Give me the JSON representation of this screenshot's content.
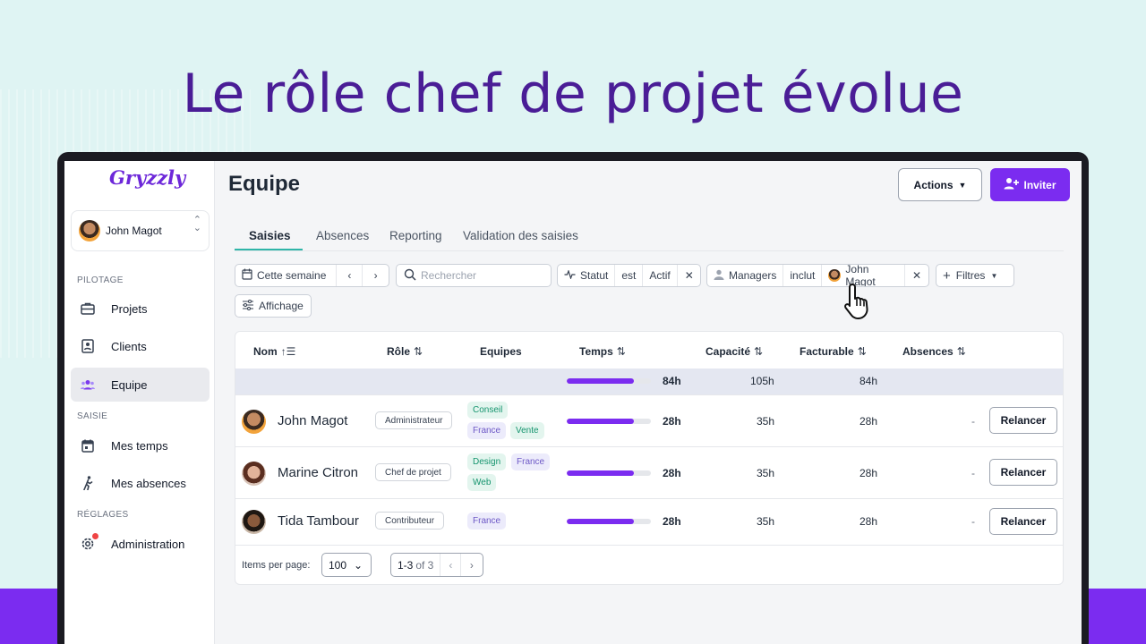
{
  "headline": "Le rôle chef de projet évolue",
  "app": {
    "logo": "Gryzzly",
    "current_user": "John Magot"
  },
  "sidebar": {
    "sections": {
      "pilotage": "PILOTAGE",
      "saisie": "SAISIE",
      "reglages": "RÉGLAGES"
    },
    "items": [
      {
        "label": "Projets",
        "icon": "briefcase-icon"
      },
      {
        "label": "Clients",
        "icon": "contact-card-icon"
      },
      {
        "label": "Equipe",
        "icon": "team-icon",
        "active": true
      },
      {
        "label": "Mes temps",
        "icon": "calendar-icon"
      },
      {
        "label": "Mes absences",
        "icon": "walking-person-icon"
      },
      {
        "label": "Administration",
        "icon": "gear-icon",
        "has_notification": true
      }
    ]
  },
  "header": {
    "title": "Equipe",
    "actions_label": "Actions",
    "invite_label": "Inviter"
  },
  "tabs": [
    "Saisies",
    "Absences",
    "Reporting",
    "Validation des saisies"
  ],
  "active_tab": "Saisies",
  "filters": {
    "period": "Cette semaine",
    "search_placeholder": "Rechercher",
    "statut": {
      "field": "Statut",
      "op": "est",
      "value": "Actif"
    },
    "managers": {
      "field": "Managers",
      "op": "inclut",
      "value": "John Magot"
    },
    "filters_label": "Filtres",
    "display_label": "Affichage"
  },
  "table": {
    "columns": [
      "Nom",
      "Rôle",
      "Equipes",
      "Temps",
      "Capacité",
      "Facturable",
      "Absences"
    ],
    "totals": {
      "temps": "84h",
      "temps_fraction": 0.8,
      "capacite": "105h",
      "facturable": "84h"
    },
    "rows": [
      {
        "name": "John Magot",
        "role": "Administrateur",
        "teams": [
          "Conseil",
          "France",
          "Vente"
        ],
        "temps": "28h",
        "temps_fraction": 0.8,
        "capacite": "35h",
        "facturable": "28h",
        "absences": "-",
        "action": "Relancer"
      },
      {
        "name": "Marine Citron",
        "role": "Chef de projet",
        "teams": [
          "Design",
          "France",
          "Web"
        ],
        "temps": "28h",
        "temps_fraction": 0.8,
        "capacite": "35h",
        "facturable": "28h",
        "absences": "-",
        "action": "Relancer"
      },
      {
        "name": "Tida Tambour",
        "role": "Contributeur",
        "teams": [
          "France"
        ],
        "temps": "28h",
        "temps_fraction": 0.8,
        "capacite": "35h",
        "facturable": "28h",
        "absences": "-",
        "action": "Relancer"
      }
    ]
  },
  "pagination": {
    "items_per_page_label": "Items per page:",
    "items_per_page": "100",
    "range": "1-3",
    "of": "of 3"
  },
  "colors": {
    "brand": "#7b2cf0",
    "headline": "#4a1d96",
    "tag_green": "#15946e",
    "tag_purple": "#6d58c6",
    "background": "#dff4f3"
  }
}
